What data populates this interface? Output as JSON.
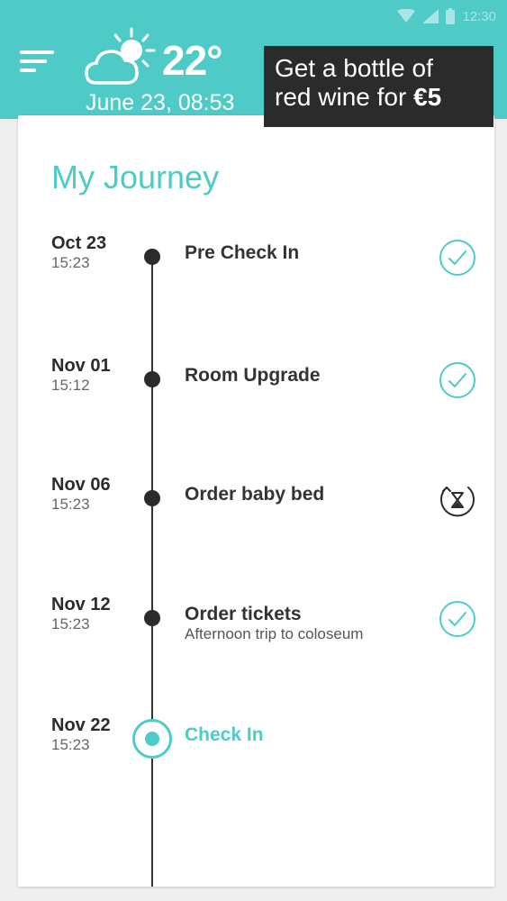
{
  "status_bar": {
    "time": "12:30",
    "icons": [
      "wifi-icon",
      "signal-icon",
      "battery-icon"
    ]
  },
  "header": {
    "menu_icon": "hamburger-menu-icon",
    "weather_icon": "partly-cloudy-icon",
    "temperature": "22°",
    "datetime": "June 23, 08:53"
  },
  "promo": {
    "line1": "Get a bottle of",
    "line2_prefix": "red wine for ",
    "price": "€5"
  },
  "journey": {
    "title": "My Journey",
    "entries": [
      {
        "date": "Oct 23",
        "time": "15:23",
        "title": "Pre Check In",
        "subtitle": "",
        "status": "completed-check-icon"
      },
      {
        "date": "Nov 01",
        "time": "15:12",
        "title": "Room Upgrade",
        "subtitle": "",
        "status": "completed-check-icon"
      },
      {
        "date": "Nov 06",
        "time": "15:23",
        "title": "Order baby bed",
        "subtitle": "",
        "status": "pending-hourglass-icon"
      },
      {
        "date": "Nov 12",
        "time": "15:23",
        "title": "Order tickets",
        "subtitle": "Afternoon trip to coloseum",
        "status": "completed-check-icon"
      },
      {
        "date": "Nov 22",
        "time": "15:23",
        "title": "Check In",
        "subtitle": "",
        "status": "current"
      }
    ]
  },
  "colors": {
    "accent": "#4ecbc7",
    "dark": "#2b2b2b",
    "background": "#efefef",
    "card": "#ffffff"
  }
}
